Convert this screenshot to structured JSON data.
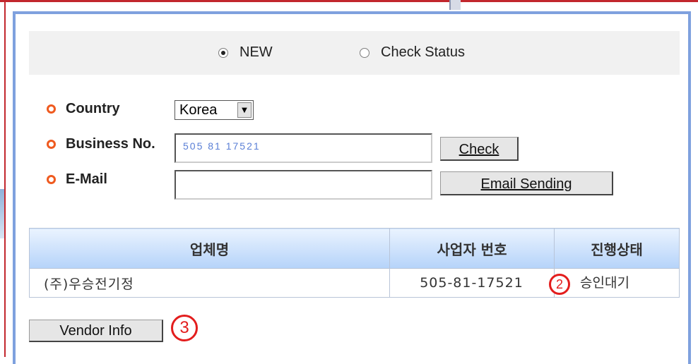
{
  "mode": {
    "options": [
      {
        "label": "NEW",
        "selected": true
      },
      {
        "label": "Check Status",
        "selected": false
      }
    ]
  },
  "form": {
    "country_label": "Country",
    "country_value": "Korea",
    "business_label": "Business No.",
    "business_value": "505 81 17521",
    "email_label": "E-Mail",
    "email_value": "",
    "check_button": "Check",
    "email_button": "Email Sending"
  },
  "table": {
    "headers": [
      "업체명",
      "사업자 번호",
      "진행상태"
    ],
    "rows": [
      {
        "company": "(주)우승전기정",
        "business_no": "505-81-17521",
        "status": "승인대기"
      }
    ]
  },
  "vendor_button": "Vendor Info",
  "markers": {
    "status": "2",
    "vendor": "3"
  },
  "colors": {
    "panel_border": "#7fa1de",
    "outer_border": "#c2272d",
    "bullet": "#ef5a1f",
    "marker": "#e31d1d"
  }
}
